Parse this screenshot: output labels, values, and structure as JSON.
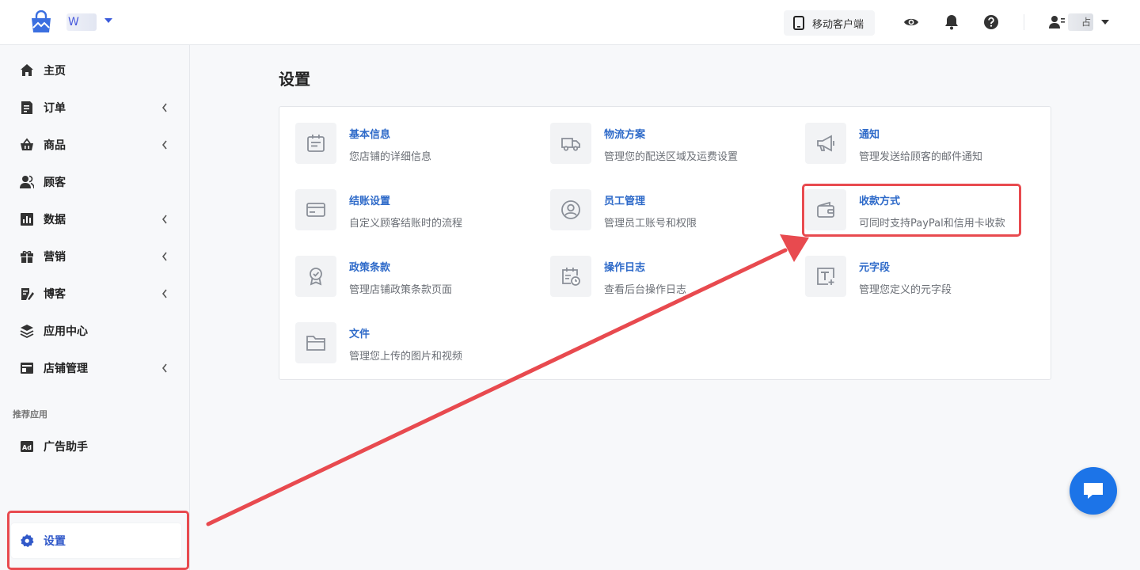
{
  "header": {
    "store_name": "W",
    "mobile_client": "移动客户端",
    "user_name": "占",
    "icons": [
      "logo-bag-icon",
      "phone-icon",
      "eye-icon",
      "bell-icon",
      "help-icon",
      "user-icon"
    ]
  },
  "sidebar": {
    "items": [
      {
        "label": "主页",
        "icon": "home-icon"
      },
      {
        "label": "订单",
        "icon": "order-icon",
        "expandable": true
      },
      {
        "label": "商品",
        "icon": "basket-icon",
        "expandable": true
      },
      {
        "label": "顾客",
        "icon": "customers-icon"
      },
      {
        "label": "数据",
        "icon": "chart-icon",
        "expandable": true
      },
      {
        "label": "营销",
        "icon": "gift-icon",
        "expandable": true
      },
      {
        "label": "博客",
        "icon": "blog-icon",
        "expandable": true
      },
      {
        "label": "应用中心",
        "icon": "layers-icon"
      },
      {
        "label": "店铺管理",
        "icon": "store-icon",
        "expandable": true
      }
    ],
    "recommended_label": "推荐应用",
    "recommended": [
      {
        "label": "广告助手",
        "icon": "ad-icon"
      }
    ],
    "settings_label": "设置"
  },
  "main": {
    "title": "设置",
    "tiles": [
      {
        "title": "基本信息",
        "desc": "您店铺的详细信息",
        "icon": "calendar-note-icon"
      },
      {
        "title": "物流方案",
        "desc": "管理您的配送区域及运费设置",
        "icon": "truck-icon"
      },
      {
        "title": "通知",
        "desc": "管理发送给顾客的邮件通知",
        "icon": "megaphone-icon"
      },
      {
        "title": "结账设置",
        "desc": "自定义顾客结账时的流程",
        "icon": "card-icon"
      },
      {
        "title": "员工管理",
        "desc": "管理员工账号和权限",
        "icon": "user-circle-icon"
      },
      {
        "title": "收款方式",
        "desc": "可同时支持PayPal和信用卡收款",
        "icon": "wallet-icon"
      },
      {
        "title": "政策条款",
        "desc": "管理店铺政策条款页面",
        "icon": "badge-icon"
      },
      {
        "title": "操作日志",
        "desc": "查看后台操作日志",
        "icon": "calendar-clock-icon"
      },
      {
        "title": "元字段",
        "desc": "管理您定义的元字段",
        "icon": "text-plus-icon"
      },
      {
        "title": "文件",
        "desc": "管理您上传的图片和视频",
        "icon": "folder-icon"
      }
    ]
  },
  "colors": {
    "accent": "#2e6ac9",
    "annotation": "#e84a4f",
    "chat": "#1c74e8"
  }
}
